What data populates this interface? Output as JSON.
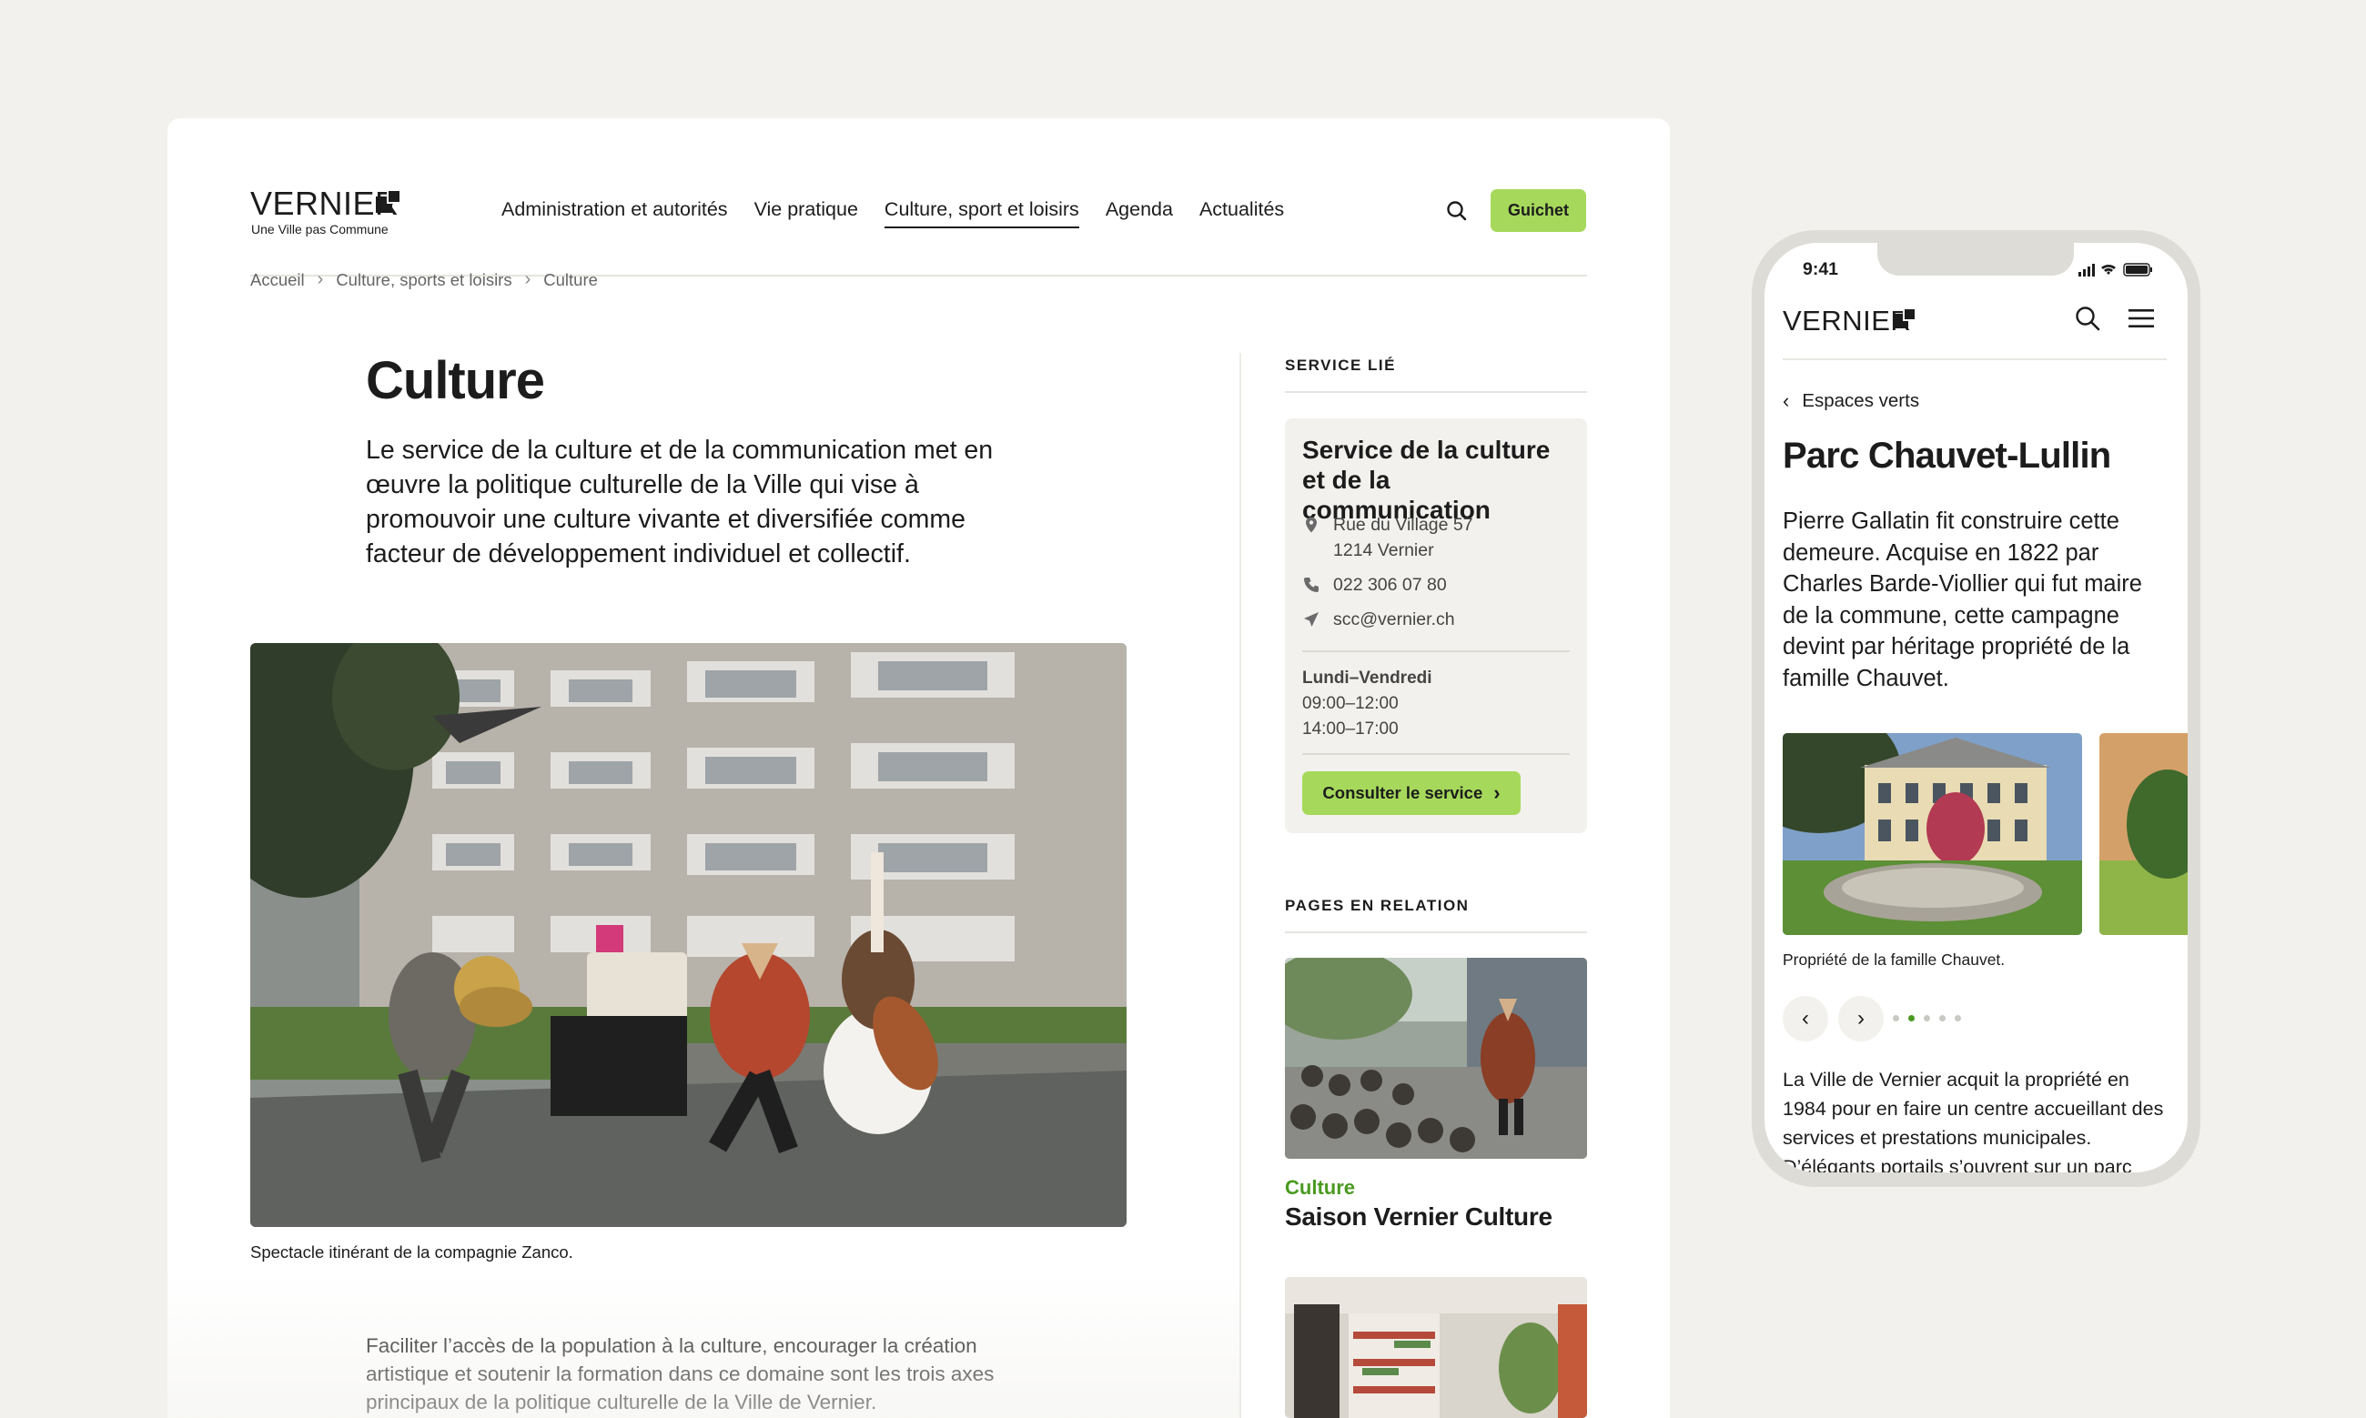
{
  "desktop": {
    "logo": {
      "word": "VERNIER",
      "tagline": "Une Ville pas Commune"
    },
    "nav": [
      {
        "label": "Administration et autorités",
        "active": false
      },
      {
        "label": "Vie pratique",
        "active": false
      },
      {
        "label": "Culture, sport et loisirs",
        "active": true
      },
      {
        "label": "Agenda",
        "active": false
      },
      {
        "label": "Actualités",
        "active": false
      }
    ],
    "search_icon": "search-icon",
    "guichet_label": "Guichet",
    "breadcrumb": [
      "Accueil",
      "Culture, sports et loisirs",
      "Culture"
    ],
    "title": "Culture",
    "lead": "Le service de la culture et de la communication met en œuvre la politique culturelle de la Ville qui vise à promouvoir une culture vivante et diversifiée comme facteur de développement individuel et collectif.",
    "photo_caption": "Spectacle itinérant de la compagnie Zanco.",
    "body": "Faciliter l’accès de la population à la culture, encourager la création artistique et soutenir la formation dans ce domaine sont les trois axes principaux de la politique culturelle de la Ville de Vernier.",
    "sidebar": {
      "service_label": "SERVICE LIÉ",
      "service": {
        "title": "Service de la culture et de la communication",
        "address_line1": "Rue du Village 57",
        "address_line2": "1214 Vernier",
        "phone": "022 306 07 80",
        "email": "scc@vernier.ch",
        "hours_days": "Lundi–Vendredi",
        "hours_morning": "09:00–12:00",
        "hours_afternoon": "14:00–17:00",
        "button_label": "Consulter le service"
      },
      "related_label": "PAGES EN RELATION",
      "related": [
        {
          "category": "Culture",
          "title": "Saison Vernier Culture"
        }
      ]
    }
  },
  "mobile": {
    "time": "9:41",
    "logo_word": "VERNIER",
    "back_label": "Espaces verts",
    "title": "Parc Chauvet-Lullin",
    "lead": "Pierre Gallatin fit construire cette demeure. Acquise en 1822 par Charles Barde-Viollier qui fut maire de la commune, cette campagne devint par héritage propriété de la famille Chauvet.",
    "caption": "Propriété de la famille Chauvet.",
    "carousel": {
      "count": 5,
      "active_index": 1
    },
    "body": "La Ville de Vernier acquit la propriété en 1984 pour en faire un centre accueillant des services et prestations municipales. D’élégants portails s’ouvrent sur un parc"
  },
  "colors": {
    "accent_green": "#a6d95b",
    "category_green": "#4a9a20",
    "background": "#f2f1ed"
  }
}
